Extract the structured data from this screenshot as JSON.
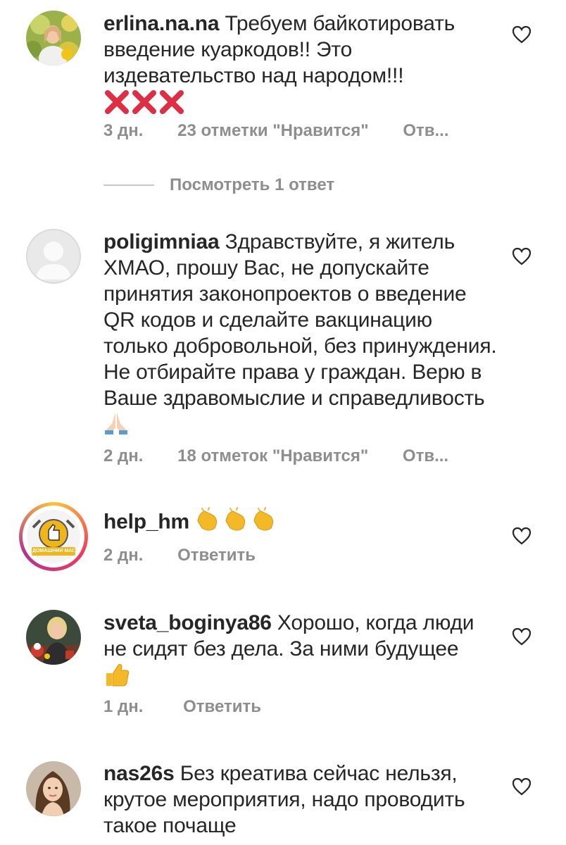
{
  "comments": [
    {
      "username": "erlina.na.na",
      "text": " Требуем байкотировать введение куаркодов!! Это издевательство над народом!!!",
      "emoji": "cross-marks",
      "time": "3 дн.",
      "likes": "23 отметки \"Нравится\"",
      "reply": "Отв..."
    },
    {
      "username": "poligimniaa",
      "text": " Здравствуйте, я житель ХМАО, прошу Вас, не допускайте принятия законопроектов о введение QR кодов и сделайте вакцинацию только добровольной, без принуждения. Не отбирайте права у граждан. Верю в Ваше здравомыслие и справедливость ",
      "emoji": "folded-hands",
      "time": "2 дн.",
      "likes": "18 отметок \"Нравится\"",
      "reply": "Отв..."
    },
    {
      "username": "help_hm",
      "text": " ",
      "emoji": "clapping-hands",
      "time": "2 дн.",
      "reply": "Ответить"
    },
    {
      "username": "sveta_boginya86",
      "text": " Хорошо, когда люди не сидят без дела. За ними будущее",
      "emoji": "thumbs-up",
      "time": "1 дн.",
      "reply": "Ответить"
    },
    {
      "username": "nas26s",
      "text": " Без креатива сейчас нельзя, крутое мероприятия, надо проводить такое почаще"
    }
  ],
  "view_replies": "Посмотреть 1 ответ",
  "avatar3_text": "ДОМАШНИЙ МАСТЕР",
  "colors": {
    "meta": "#8e8e8e",
    "text": "#262626",
    "heart": "#262626"
  }
}
